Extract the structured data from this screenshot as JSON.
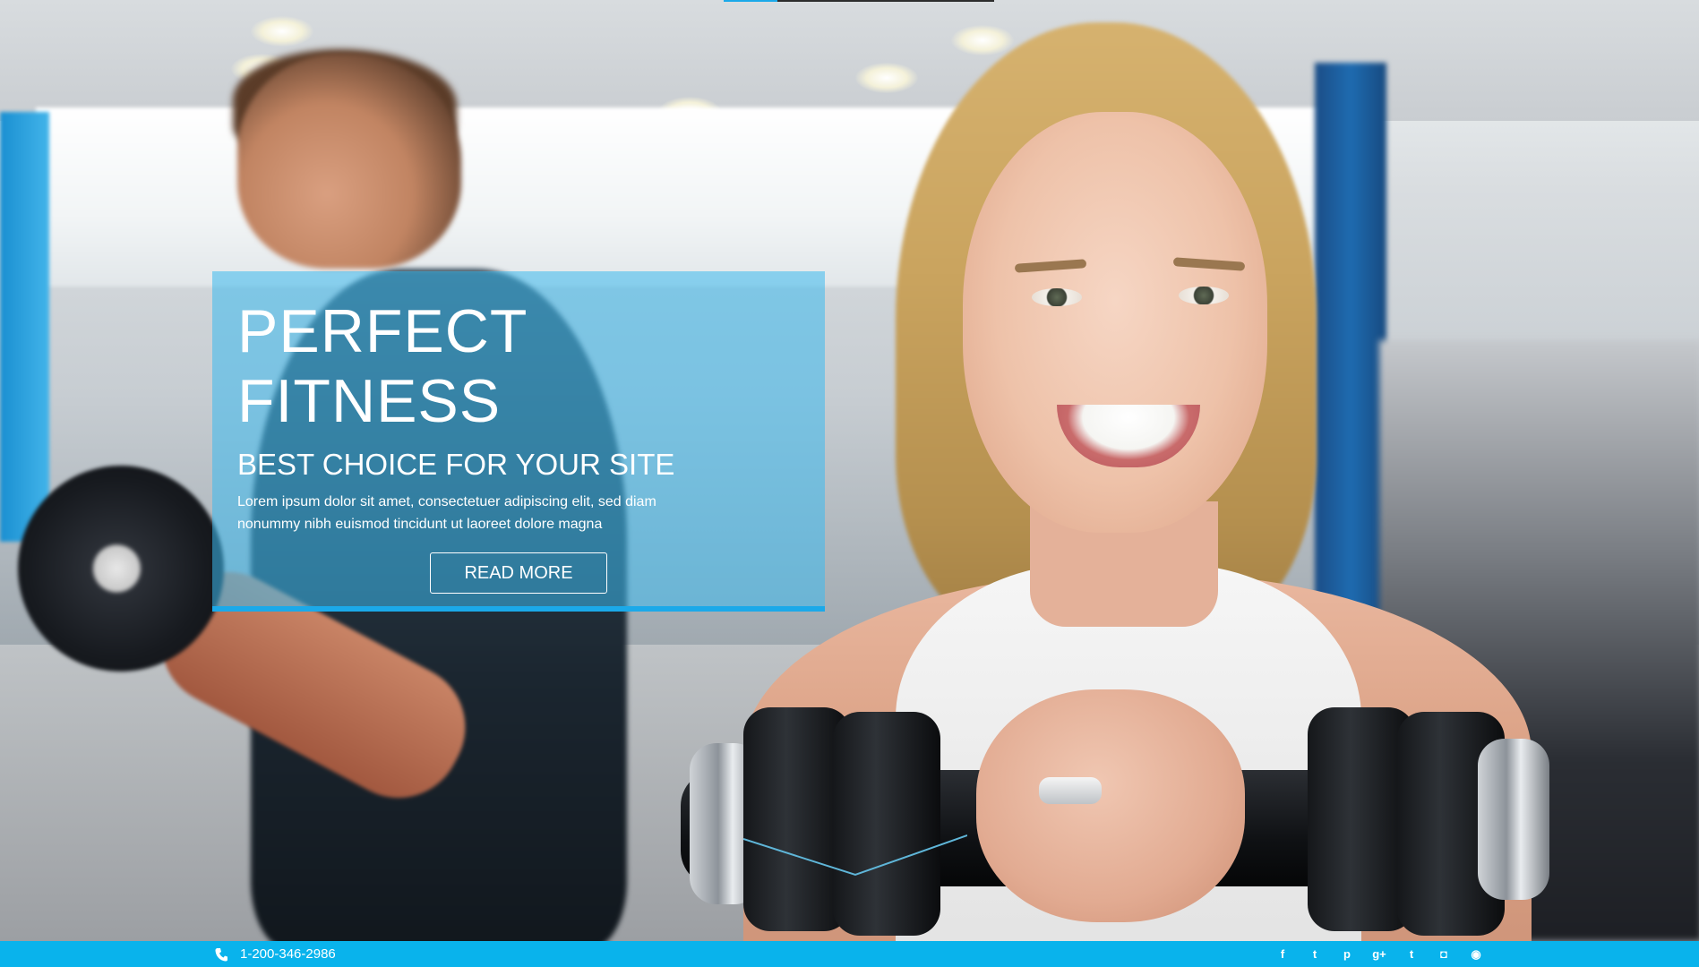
{
  "top_progress": {
    "value_fraction": 0.2
  },
  "hero": {
    "title_line1": "PERFECT",
    "title_line2": "FITNESS",
    "subtitle": "BEST CHOICE FOR YOUR SITE",
    "text_line1": "Lorem ipsum dolor sit amet, consectetuer adipiscing elit, sed diam",
    "text_line2": "nonummy nibh euismod tincidunt ut laoreet dolore magna",
    "button_label": "READ MORE"
  },
  "footer": {
    "phone": "1-200-346-2986",
    "phone_icon": "phone-icon",
    "socials": [
      {
        "name": "facebook-icon",
        "glyph": "f"
      },
      {
        "name": "twitter-icon",
        "glyph": "t"
      },
      {
        "name": "pinterest-icon",
        "glyph": "p"
      },
      {
        "name": "google-plus-icon",
        "glyph": "g+"
      },
      {
        "name": "tumblr-icon",
        "glyph": "t"
      },
      {
        "name": "instagram-icon",
        "glyph": "◘"
      },
      {
        "name": "rss-icon",
        "glyph": "◉"
      }
    ]
  },
  "colors": {
    "accent": "#1ba9e9",
    "bottom_bar": "#09b3ec",
    "overlay": "rgba(60,186,238,0.55)"
  }
}
